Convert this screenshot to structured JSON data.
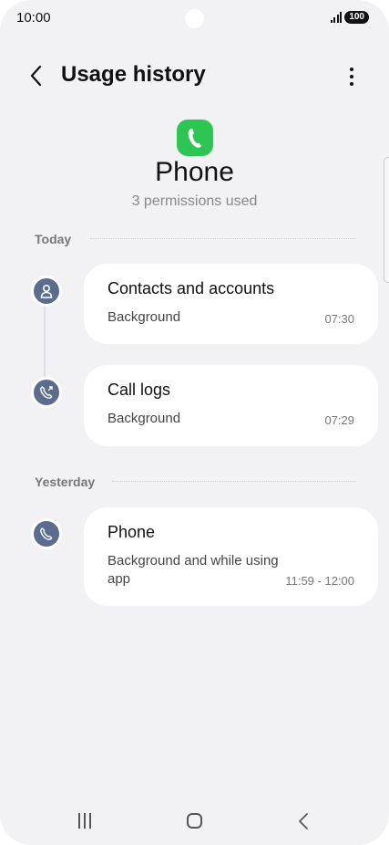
{
  "status_bar": {
    "time": "10:00",
    "battery": "100"
  },
  "header": {
    "title": "Usage history"
  },
  "app": {
    "name": "Phone",
    "permissions": "3 permissions used"
  },
  "sections": [
    {
      "label": "Today",
      "items": [
        {
          "title": "Contacts and accounts",
          "mode": "Background",
          "time": "07:30",
          "icon": "contact-icon"
        },
        {
          "title": "Call logs",
          "mode": "Background",
          "time": "07:29",
          "icon": "call-log-icon"
        }
      ]
    },
    {
      "label": "Yesterday",
      "items": [
        {
          "title": "Phone",
          "mode_line1": "Background and while using",
          "mode_line2": "app",
          "time": "11:59 - 12:00",
          "icon": "phone-icon"
        }
      ]
    }
  ],
  "colors": {
    "app_icon": "#2dc653",
    "pin": "#5b6d8e",
    "background": "#f2f2f4"
  }
}
